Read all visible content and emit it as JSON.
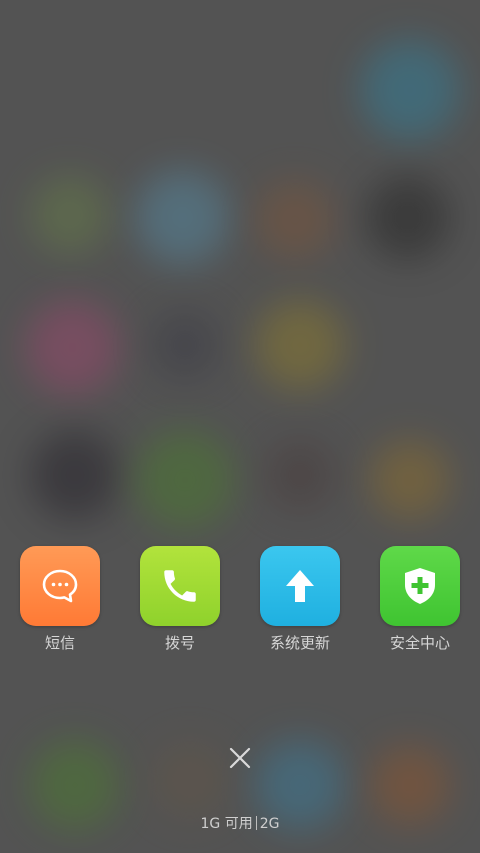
{
  "recent_apps": [
    {
      "label": "短信",
      "icon": "message-bubble-icon",
      "color_top": "#ff9a56",
      "color_bottom": "#ff7a35"
    },
    {
      "label": "拨号",
      "icon": "phone-icon",
      "color_top": "#b2e33c",
      "color_bottom": "#8fd22c"
    },
    {
      "label": "系统更新",
      "icon": "up-arrow-icon",
      "color_top": "#3bc7ef",
      "color_bottom": "#1fb0e0"
    },
    {
      "label": "安全中心",
      "icon": "shield-plus-icon",
      "color_top": "#5fd949",
      "color_bottom": "#3fc431"
    }
  ],
  "close_icon": "close-icon",
  "memory": {
    "available": "1G 可用",
    "total": "2G"
  }
}
